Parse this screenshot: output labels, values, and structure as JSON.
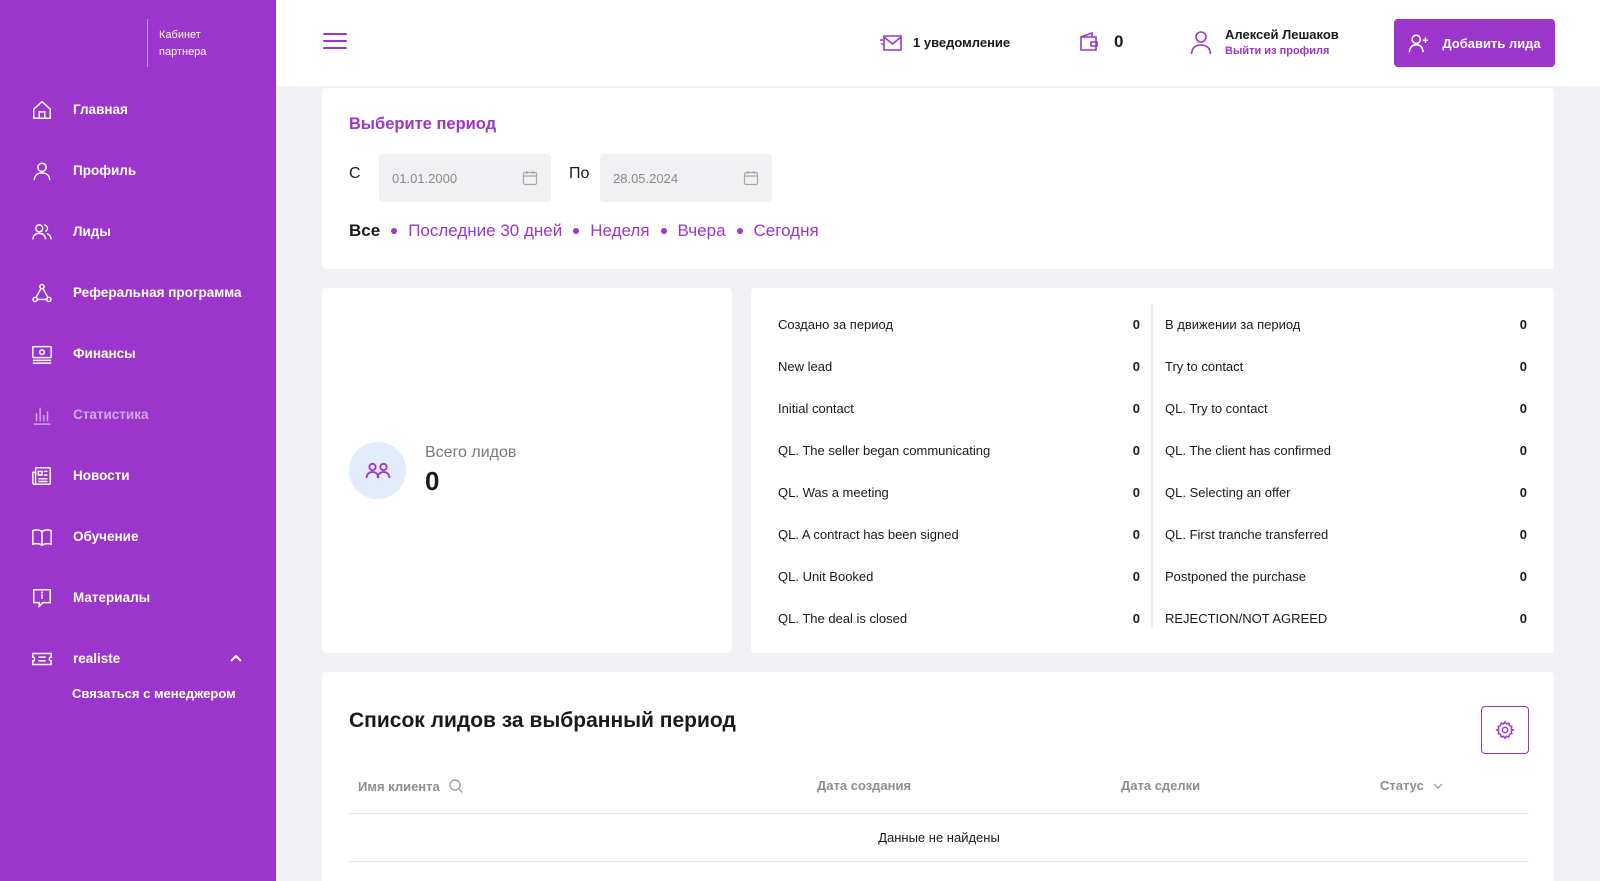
{
  "brand": {
    "subtitle_line1": "Кабинет",
    "subtitle_line2": "партнера"
  },
  "sidebar": {
    "items": [
      {
        "label": "Главная",
        "icon": "home-icon"
      },
      {
        "label": "Профиль",
        "icon": "user-icon"
      },
      {
        "label": "Лиды",
        "icon": "users-icon"
      },
      {
        "label": "Реферальная программа",
        "icon": "referral-icon"
      },
      {
        "label": "Финансы",
        "icon": "money-icon"
      },
      {
        "label": "Статистика",
        "icon": "chart-icon"
      },
      {
        "label": "Новости",
        "icon": "news-icon"
      },
      {
        "label": "Обучение",
        "icon": "book-icon"
      },
      {
        "label": "Материалы",
        "icon": "info-icon"
      },
      {
        "label": "realiste",
        "icon": "ticket-icon"
      }
    ],
    "sub_item": "Связаться с менеджером"
  },
  "header": {
    "notifications": "1 уведомление",
    "wallet_balance": "0",
    "user_name": "Алексей Лешаков",
    "logout": "Выйти из профиля",
    "add_lead": "Добавить лида"
  },
  "period": {
    "title": "Выберите период",
    "from_label": "С",
    "from_value": "01.01.2000",
    "to_label": "По",
    "to_value": "28.05.2024",
    "quick": [
      "Все",
      "Последние 30 дней",
      "Неделя",
      "Вчера",
      "Сегодня"
    ]
  },
  "total": {
    "label": "Всего лидов",
    "value": "0"
  },
  "stats": {
    "left": [
      {
        "name": "Создано за период",
        "value": "0"
      },
      {
        "name": "New lead",
        "value": "0"
      },
      {
        "name": "Initial contact",
        "value": "0"
      },
      {
        "name": "QL. The seller began communicating",
        "value": "0"
      },
      {
        "name": "QL. Was a meeting",
        "value": "0"
      },
      {
        "name": "QL. A contract has been signed",
        "value": "0"
      },
      {
        "name": "QL. Unit Booked",
        "value": "0"
      },
      {
        "name": "QL. The deal is closed",
        "value": "0"
      }
    ],
    "right": [
      {
        "name": "В движении за период",
        "value": "0"
      },
      {
        "name": "Try to contact",
        "value": "0"
      },
      {
        "name": "QL. Try to contact",
        "value": "0"
      },
      {
        "name": "QL. The client has confirmed",
        "value": "0"
      },
      {
        "name": "QL. Selecting an offer",
        "value": "0"
      },
      {
        "name": "QL. First tranche transferred",
        "value": "0"
      },
      {
        "name": "Postponed the purchase",
        "value": "0"
      },
      {
        "name": "REJECTION/NOT AGREED",
        "value": "0"
      }
    ]
  },
  "leads": {
    "title": "Список лидов за выбранный период",
    "columns": [
      "Имя клиента",
      "Дата создания",
      "Дата сделки",
      "Статус"
    ],
    "empty": "Данные не найдены"
  },
  "colors": {
    "accent": "#9b35cc",
    "background": "#f1f1f5"
  }
}
